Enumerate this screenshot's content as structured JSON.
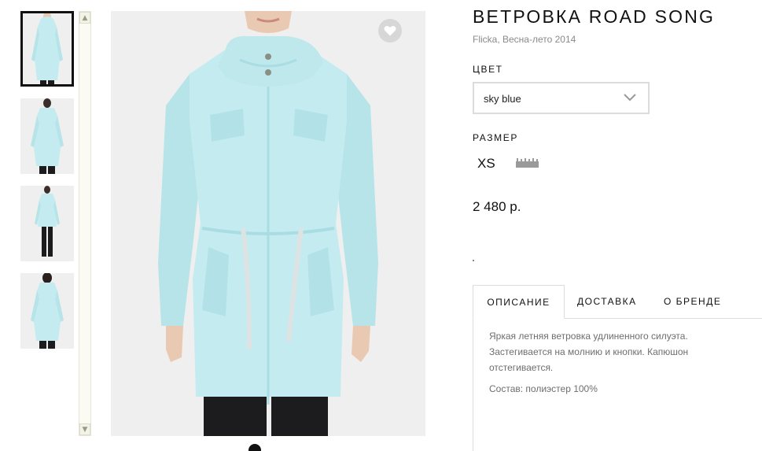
{
  "product": {
    "title": "ВЕТРОВКА ROAD SONG",
    "brand_season": "Flicka, Весна-лето 2014",
    "color_label": "ЦВЕТ",
    "color_value": "sky blue",
    "size_label": "РАЗМЕР",
    "size_value": "XS",
    "price": "2 480 р."
  },
  "tabs": [
    {
      "label": "ОПИСАНИЕ",
      "active": true
    },
    {
      "label": "ДОСТАВКА",
      "active": false
    },
    {
      "label": "О БРЕНДЕ",
      "active": false
    }
  ],
  "description": {
    "text": "Яркая летняя ветровка удлиненного силуэта. Застегивается на молнию и кнопки. Капюшон отстегивается.",
    "composition": "Состав: полиэстер 100%"
  },
  "gallery": {
    "thumbnail_count": 4,
    "selected_index": 0
  },
  "icons": {
    "favorite": "heart-icon",
    "size_guide": "ruler-icon",
    "dropdown": "chevron-down-icon",
    "scroll_up": "arrow-up-icon",
    "scroll_down": "arrow-down-icon",
    "zoom": "zoom-icon"
  },
  "colors": {
    "jacket": "#c4ecf0",
    "jacket_shade": "#a9dde3",
    "pants": "#1c1c1e",
    "skin": "#e9c9b2",
    "background": "#efefef",
    "favorite_bg": "#d7d7d7",
    "border": "#dcdcdc"
  }
}
